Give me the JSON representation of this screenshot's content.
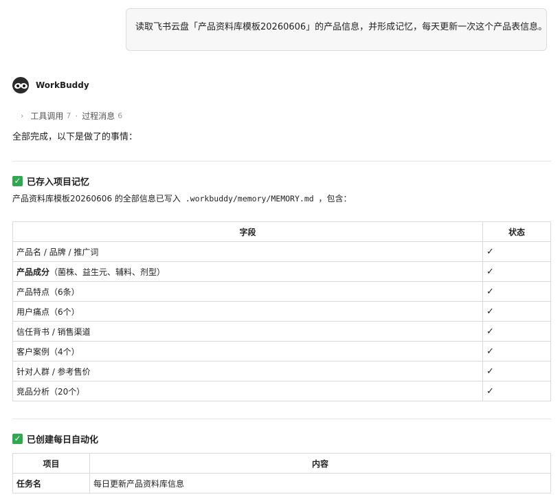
{
  "user_message": "读取飞书云盘「产品资料库模板20260606」的产品信息，并形成记忆，每天更新一次这个产品表信息。",
  "assistant": {
    "name": "WorkBuddy",
    "tool_summary": {
      "tool_label": "工具调用",
      "tool_count": "7",
      "process_label": "过程消息",
      "process_count": "6"
    },
    "intro": "全部完成，以下是做了的事情："
  },
  "section1": {
    "title": "已存入项目记忆",
    "desc_prefix": "产品资料库模板20260606 的全部信息已写入",
    "desc_path": ".workbuddy/memory/MEMORY.md",
    "desc_suffix": "，包含：",
    "table": {
      "headers": [
        "字段",
        "状态"
      ],
      "rows": [
        {
          "bold": "",
          "text": "产品名 / 品牌 / 推广词",
          "status": "✓"
        },
        {
          "bold": "产品成分",
          "text": "（菌株、益生元、辅料、剂型）",
          "status": "✓"
        },
        {
          "bold": "",
          "text": "产品特点（6条）",
          "status": "✓"
        },
        {
          "bold": "",
          "text": "用户痛点（6个）",
          "status": "✓"
        },
        {
          "bold": "",
          "text": "信任背书 / 销售渠道",
          "status": "✓"
        },
        {
          "bold": "",
          "text": "客户案例（4个）",
          "status": "✓"
        },
        {
          "bold": "",
          "text": "针对人群 / 参考售价",
          "status": "✓"
        },
        {
          "bold": "",
          "text": "竞品分析（20个）",
          "status": "✓"
        }
      ]
    }
  },
  "section2": {
    "title": "已创建每日自动化",
    "table": {
      "headers": [
        "项目",
        "内容"
      ],
      "rows": [
        {
          "label": "任务名",
          "value": "每日更新产品资料库信息"
        }
      ]
    }
  },
  "colors": {
    "check_green": "#2fa84f"
  }
}
